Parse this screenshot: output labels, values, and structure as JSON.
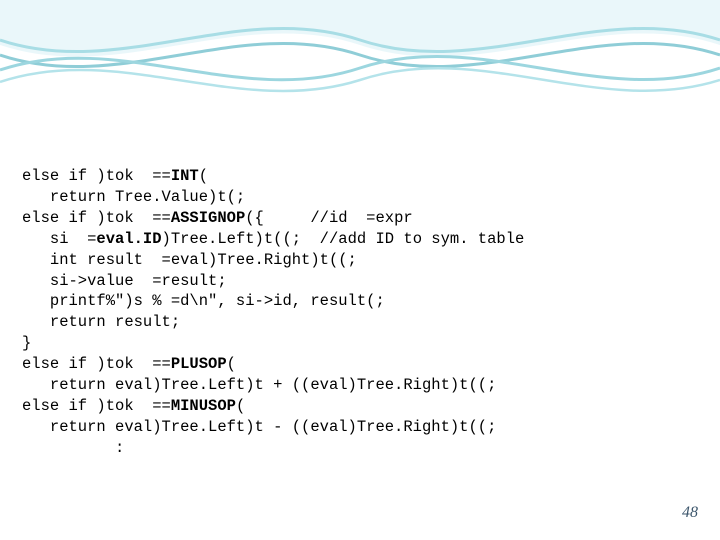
{
  "wave": {
    "stroke1": "#95d6e0",
    "stroke2": "#7fbac4",
    "fill": "#c9ecf1"
  },
  "code": {
    "l1a": "else if )tok  ==",
    "l1b": "INT",
    "l1c": "(",
    "l2": "   return Tree.Value)t(;",
    "l3a": "else if )tok  ==",
    "l3b": "ASSIGNOP",
    "l3c": "({     //id  =expr",
    "l4a": "   si  =",
    "l4b": "eval.ID",
    "l4c": ")Tree.Left)t((;  //add ID to sym. table",
    "l5": "   int result  =eval)Tree.Right)t((;",
    "l6": "   si->value  =result;",
    "l7": "   printf%\")s % =d\\n\", si->id, result(;",
    "l8": "   return result;",
    "l9": "}",
    "l10a": "else if )tok  ==",
    "l10b": "PLUSOP",
    "l10c": "(",
    "l11": "   return eval)Tree.Left)t + ((eval)Tree.Right)t((;",
    "l12a": "else if )tok  ==",
    "l12b": "MINUSOP",
    "l12c": "(",
    "l13": "   return eval)Tree.Left)t - ((eval)Tree.Right)t((;",
    "l14": "          :"
  },
  "pageNumber": "48"
}
